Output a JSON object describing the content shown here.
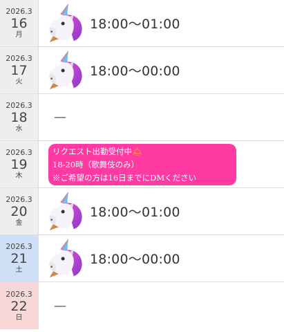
{
  "days": [
    {
      "ym": "2026.3",
      "day": "16",
      "dow": "月",
      "time": "18:00〜01:00"
    },
    {
      "ym": "2026.3",
      "day": "17",
      "dow": "火",
      "time": "18:00〜00:00"
    },
    {
      "ym": "2026.3",
      "day": "18",
      "dow": "水",
      "dash": "—"
    },
    {
      "ym": "2026.3",
      "day": "19",
      "dow": "木",
      "note": {
        "line1": "リクエスト出勤受付中",
        "bell": "🛎",
        "line2": "18-20時（歌舞伎のみ）",
        "line3": "※ご希望の方は16日までにDMください"
      }
    },
    {
      "ym": "2026.3",
      "day": "20",
      "dow": "金",
      "time": "18:00〜01:00"
    },
    {
      "ym": "2026.3",
      "day": "21",
      "dow": "土",
      "time": "18:00〜00:00"
    },
    {
      "ym": "2026.3",
      "day": "22",
      "dow": "日",
      "dash": "—"
    }
  ],
  "icons": {
    "unicorn": "unicorn-icon",
    "bell": "bell-icon"
  },
  "colors": {
    "saturday_bg": "#cfe0f6",
    "sunday_bg": "#f9d8d8",
    "note_bg": "#ff3aa2"
  }
}
